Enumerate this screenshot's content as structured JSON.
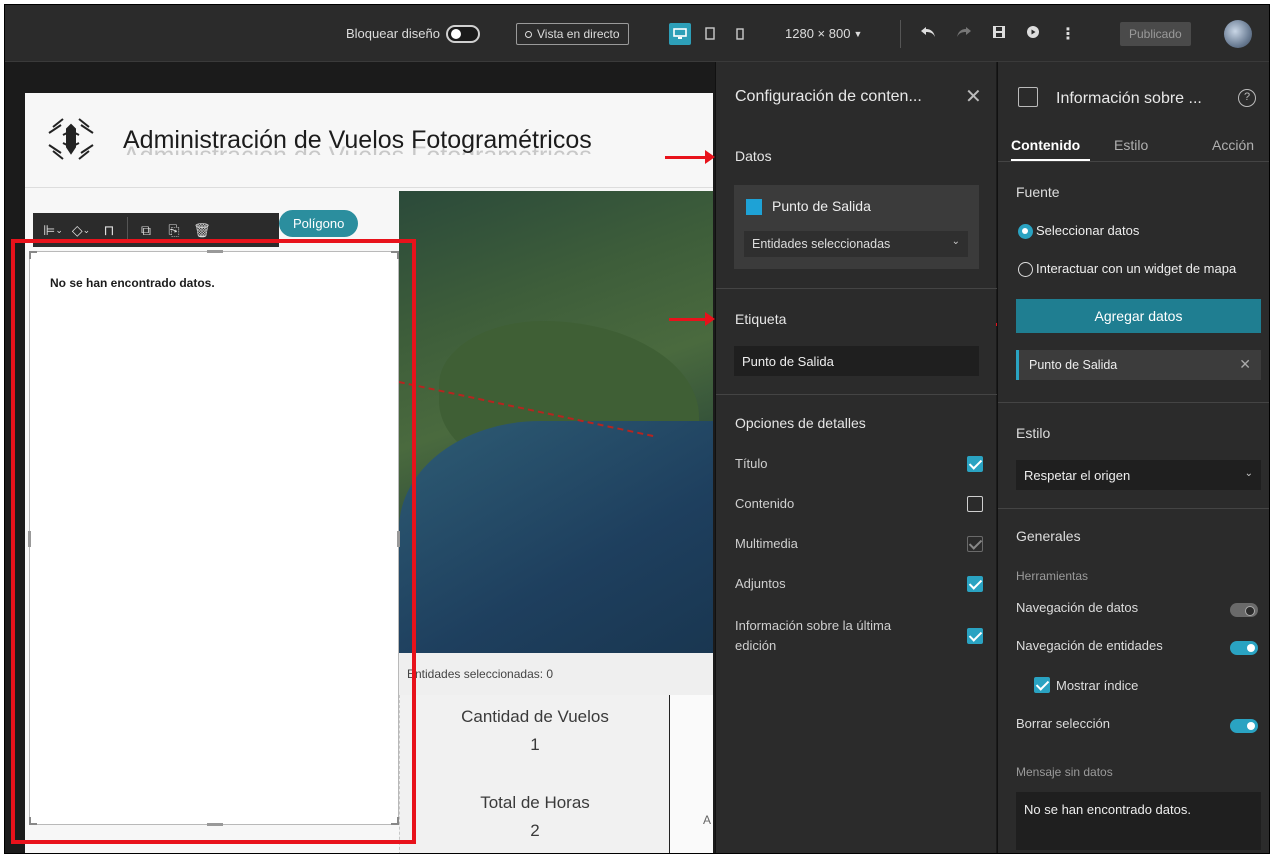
{
  "topbar": {
    "lock_layout_label": "Bloquear diseño",
    "live_view_label": "Vista en directo",
    "resolution": "1280 × 800",
    "publish_label": "Publicado",
    "accent_color": "#2d9fb8"
  },
  "page": {
    "title": "Administración de Vuelos Fotogramétricos",
    "polygon_tag": "Polígono",
    "list_empty_message": "No se han encontrado datos.",
    "map_caption": "Entidades seleccionadas: 0",
    "stats": [
      {
        "label": "Cantidad de Vuelos",
        "value": "1"
      },
      {
        "label": "Total de Horas",
        "value": "2"
      }
    ],
    "stats_right_letter": "A"
  },
  "config_panel": {
    "title": "Configuración de conten...",
    "data_section": "Datos",
    "data_source_name": "Punto de Salida",
    "data_source_filter": "Entidades seleccionadas",
    "label_section": "Etiqueta",
    "label_value": "Punto de Salida",
    "details_section": "Opciones de detalles",
    "options": [
      {
        "label": "Título",
        "state": "checked"
      },
      {
        "label": "Contenido",
        "state": "unchecked"
      },
      {
        "label": "Multimedia",
        "state": "disabled"
      },
      {
        "label": "Adjuntos",
        "state": "checked"
      },
      {
        "label": "Información sobre la última edición",
        "state": "checked"
      }
    ]
  },
  "props_panel": {
    "title": "Información sobre ...",
    "tabs": [
      "Contenido",
      "Estilo",
      "Acción"
    ],
    "source_section": "Fuente",
    "radio_select_data": "Seleccionar datos",
    "radio_interact_map": "Interactuar con un widget de mapa",
    "add_data_button": "Agregar datos",
    "selected_source": "Punto de Salida",
    "style_section": "Estilo",
    "style_value": "Respetar el origen",
    "general_section": "Generales",
    "tools_subtitle": "Herramientas",
    "data_navigation": "Navegación de datos",
    "feature_navigation": "Navegación de entidades",
    "show_index": "Mostrar índice",
    "clear_selection": "Borrar selección",
    "no_data_message_label": "Mensaje sin datos",
    "no_data_message_value": "No se han encontrado datos."
  }
}
